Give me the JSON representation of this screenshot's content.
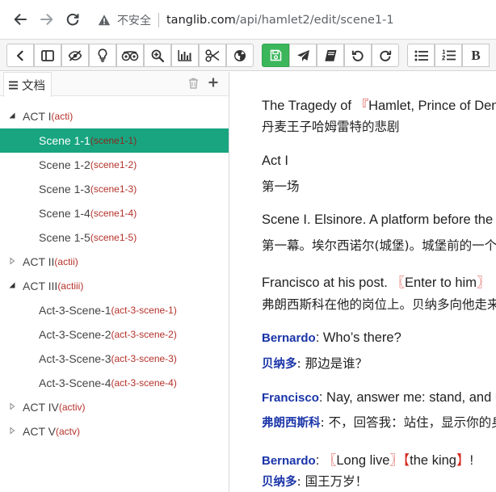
{
  "browser": {
    "insecure_label": "不安全",
    "url_host": "tanglib.com",
    "url_path": "/api/hamlet2/edit/scene1-1"
  },
  "toolbar": {
    "icons": [
      "chevron-left-icon",
      "columns-icon",
      "eye-slash-icon",
      "lightbulb-icon",
      "tripadvisor-icon",
      "zoom-in-icon",
      "bar-chart-icon",
      "scissors-icon",
      "globe-icon",
      "save-icon",
      "send-icon",
      "book-icon",
      "undo-icon",
      "redo-icon",
      "list-ul-icon",
      "list-ol-icon",
      "bold-icon"
    ],
    "bold_label": "B",
    "colors": {
      "save_green": "#3cb65b"
    }
  },
  "sidebar": {
    "tab_label": "文档",
    "selected_color": "#18a580",
    "tree": [
      {
        "title": "ACT I",
        "slug": "(acti)",
        "level": 0,
        "expanded": true
      },
      {
        "title": "Scene 1-1",
        "slug": "(scene1-1)",
        "level": 1,
        "selected": true
      },
      {
        "title": "Scene 1-2",
        "slug": "(scene1-2)",
        "level": 1
      },
      {
        "title": "Scene 1-3",
        "slug": "(scene1-3)",
        "level": 1
      },
      {
        "title": "Scene 1-4",
        "slug": "(scene1-4)",
        "level": 1
      },
      {
        "title": "Scene 1-5",
        "slug": "(scene1-5)",
        "level": 1
      },
      {
        "title": "ACT II",
        "slug": "(actii)",
        "level": 0,
        "expanded": false
      },
      {
        "title": "ACT III",
        "slug": "(actiii)",
        "level": 0,
        "expanded": true
      },
      {
        "title": "Act-3-Scene-1",
        "slug": "(act-3-scene-1)",
        "level": 1
      },
      {
        "title": "Act-3-Scene-2",
        "slug": "(act-3-scene-2)",
        "level": 1
      },
      {
        "title": "Act-3-Scene-3",
        "slug": "(act-3-scene-3)",
        "level": 1
      },
      {
        "title": "Act-3-Scene-4",
        "slug": "(act-3-scene-4)",
        "level": 1
      },
      {
        "title": "ACT IV",
        "slug": "(activ)",
        "level": 0,
        "expanded": false
      },
      {
        "title": "ACT V",
        "slug": "(actv)",
        "level": 0,
        "expanded": false
      }
    ]
  },
  "content": {
    "title_en_pre": "The Tragedy of ",
    "title_en_br_open": "『",
    "title_en_main": "Hamlet, Prince of Denmark",
    "title_zh": "丹麦王子哈姆雷特的悲剧",
    "act_en": "Act I",
    "act_zh": "第一场",
    "scene_en": "Scene I. Elsinore. A platform before the castle.",
    "scene_zh": "第一幕。埃尔西诺尔(城堡)。城堡前的一个平台。",
    "stage_en_pre": "Francisco at his post. ",
    "stage_en_br_open": "〖",
    "stage_en_mid": "Enter to him",
    "stage_en_br_close": "〗",
    "stage_zh": "弗朗西斯科在他的岗位上。贝纳多向他走来。",
    "d1_speaker_en": "Bernardo",
    "d1_text_en": ": Who’s there?",
    "d1_speaker_zh": "贝纳多",
    "d1_text_zh": ": 那边是谁？",
    "d2_speaker_en": "Francisco",
    "d2_text_en": ": Nay, answer me: stand, and unfold yourself.",
    "d2_speaker_zh": "弗朗西斯科",
    "d2_text_zh": ": 不，回答我：站住，显示你的身份。",
    "d3_speaker_en": "Bernardo",
    "d3_colon_en": ": ",
    "d3_br1_open": "〖",
    "d3_w1": "Long live",
    "d3_br1_close": "〗",
    "d3_br2_open": "【",
    "d3_w2": "the king",
    "d3_br2_close": "】",
    "d3_end": "!",
    "d3_speaker_zh": "贝纳多",
    "d3_text_zh": ": 国王万岁！"
  }
}
